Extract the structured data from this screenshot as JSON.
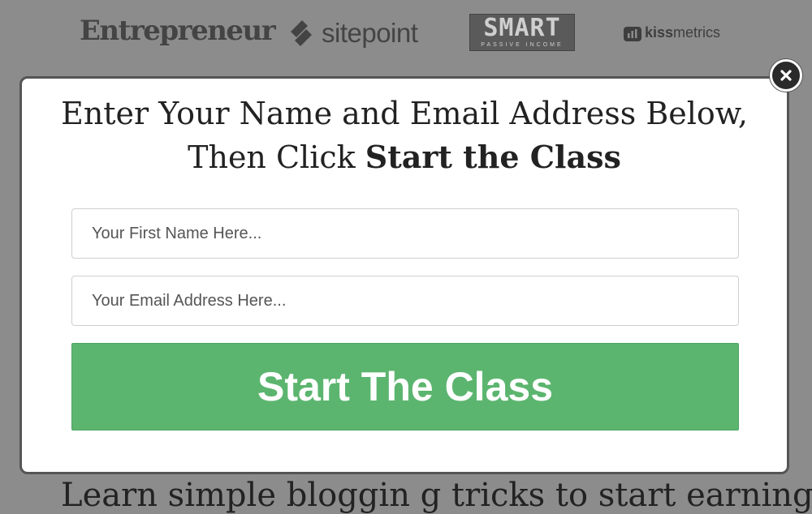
{
  "logos": {
    "entrepreneur": "Entrepreneur",
    "sitepoint": "sitepoint",
    "smart_main": "SMART",
    "smart_sub": "PASSIVE INCOME",
    "kissmetrics_bold": "kiss",
    "kissmetrics_rest": "metrics"
  },
  "background_text": "Learn simple bloggin g tricks to start earning",
  "modal": {
    "headline_part1": "Enter Your Name and Email Address Below, Then Click ",
    "headline_bold": "Start the Class",
    "first_name_placeholder": "Your First Name Here...",
    "email_placeholder": "Your Email Address Here...",
    "submit_label": "Start The Class",
    "close_icon": "close-x-icon"
  },
  "colors": {
    "overlay": "#8c8c8c",
    "button_green": "#5cb56f",
    "close_bg": "#2a2a2a"
  }
}
